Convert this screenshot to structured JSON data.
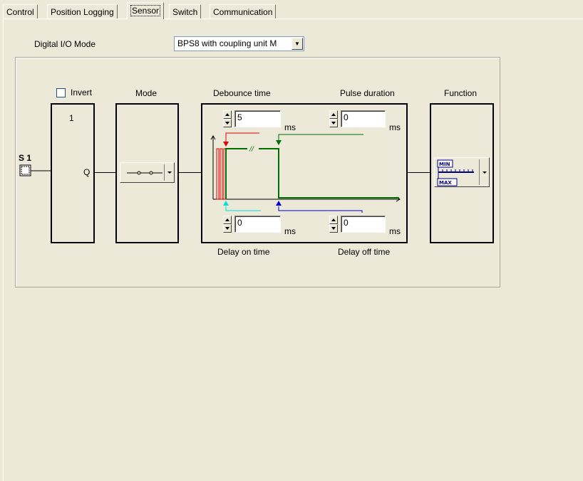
{
  "tabs": [
    {
      "label": "Control"
    },
    {
      "label": "Position Logging"
    },
    {
      "label": "Sensor"
    },
    {
      "label": "Switch"
    },
    {
      "label": "Communication"
    }
  ],
  "digital_io": {
    "label": "Digital I/O Mode",
    "value": "BPS8 with coupling unit M"
  },
  "sensor": {
    "name": "S 1",
    "invert_label": "Invert",
    "invert_checked": false,
    "gate_label": "1",
    "gate_output": "Q"
  },
  "headers": {
    "mode": "Mode",
    "debounce": "Debounce time",
    "pulse": "Pulse duration",
    "function": "Function",
    "delay_on": "Delay on time",
    "delay_off": "Delay off time"
  },
  "fields": {
    "debounce_value": "5",
    "pulse_value": "0",
    "delay_on_value": "0",
    "delay_off_value": "0",
    "unit": "ms"
  },
  "function_icon": {
    "min": "MIN",
    "max": "MAX"
  },
  "colors": {
    "signal_green": "#007000",
    "marker_red": "#e00000",
    "marker_cyan": "#00e0e0",
    "marker_blue": "#0000e0",
    "icon_blue": "#000080"
  }
}
